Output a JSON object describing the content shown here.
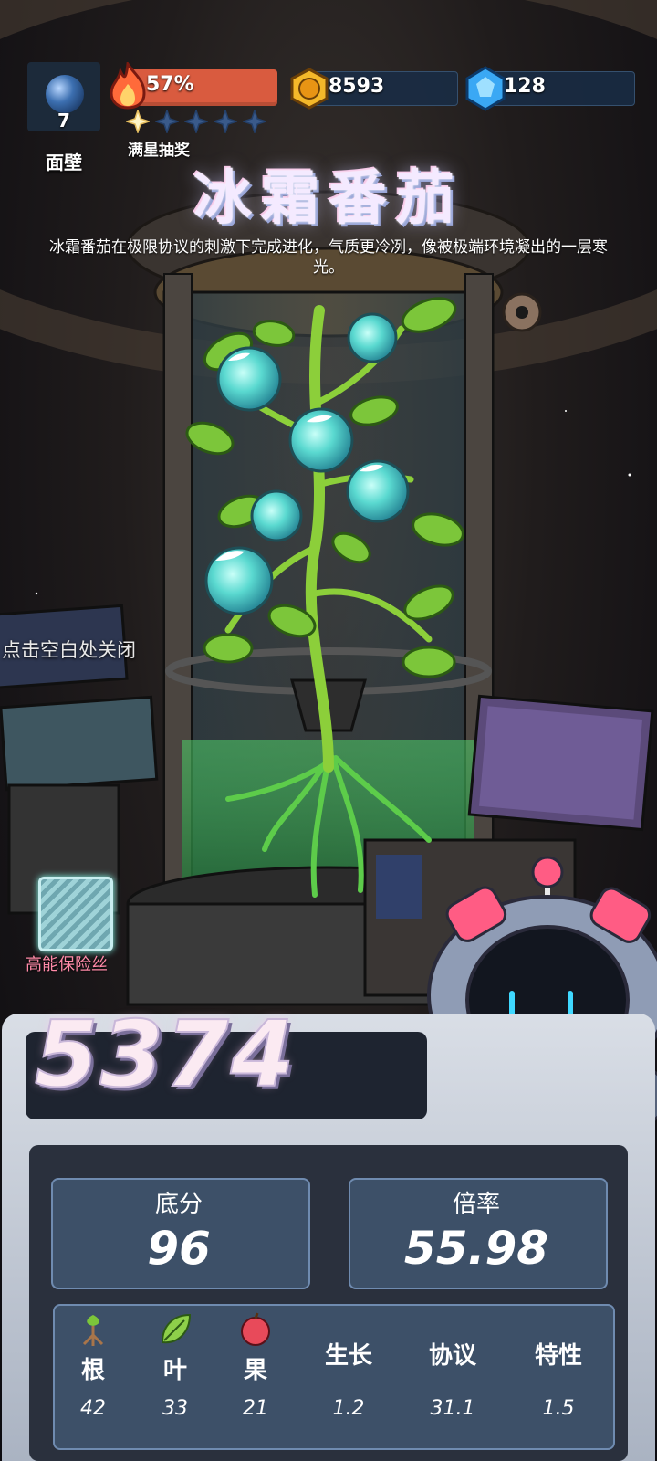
{
  "hud": {
    "level": "7",
    "profile_name": "面壁",
    "energy_percent": "57%",
    "stars_filled": 1,
    "stars_total": 5,
    "stars_label": "满星抽奖",
    "coins": "8593",
    "gems": "128"
  },
  "plant": {
    "title": "冰霜番茄",
    "description": "冰霜番茄在极限协议的刺激下完成进化，气质更冷冽，像被极端环境凝出的一层寒光。"
  },
  "close_hint": "点击空白处关闭",
  "fuse": {
    "label": "高能保险丝"
  },
  "score": {
    "total": "5374",
    "base_label": "底分",
    "base_value": "96",
    "multiplier_label": "倍率",
    "multiplier_value": "55.98"
  },
  "attributes": [
    {
      "name": "根",
      "value": "42",
      "icon": "root-icon"
    },
    {
      "name": "叶",
      "value": "33",
      "icon": "leaf-icon"
    },
    {
      "name": "果",
      "value": "21",
      "icon": "apple-icon"
    },
    {
      "name": "生长",
      "value": "1.2"
    },
    {
      "name": "协议",
      "value": "31.1"
    },
    {
      "name": "特性",
      "value": "1.5"
    }
  ],
  "colors": {
    "energy": "#d95b3f",
    "panel": "#3d5068",
    "fuse_label": "#ff8aa8",
    "robot_pink": "#ff5c84"
  }
}
